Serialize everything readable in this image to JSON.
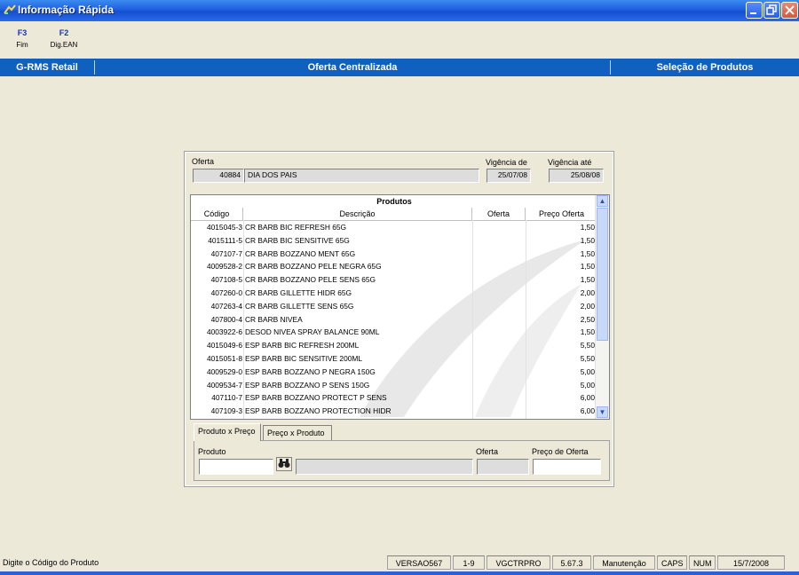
{
  "window": {
    "title": "Informação Rápida",
    "title_icon": "app-icon",
    "controls": [
      "minimize-icon",
      "restore-icon",
      "close-icon"
    ]
  },
  "shortcuts": [
    {
      "key": "F3",
      "label": "Fim"
    },
    {
      "key": "F2",
      "label": "Dig.EAN"
    }
  ],
  "header": {
    "app": "G-RMS Retail",
    "module": "Oferta Centralizada",
    "screen": "Seleção de Produtos"
  },
  "oferta": {
    "label": "Oferta",
    "codigo": "40884",
    "descricao": "DIA DOS PAIS",
    "vigencia_de_label": "Vigência de",
    "vigencia_de": "25/07/08",
    "vigencia_ate_label": "Vigência até",
    "vigencia_ate": "25/08/08"
  },
  "produtos": {
    "caption": "Produtos",
    "columns": [
      "Código",
      "Descrição",
      "Oferta",
      "Preço Oferta"
    ],
    "rows": [
      {
        "codigo": "4015045-3",
        "descricao": "CR BARB BIC REFRESH 65G",
        "oferta": "",
        "preco": "1,50"
      },
      {
        "codigo": "4015111-5",
        "descricao": "CR BARB BIC SENSITIVE 65G",
        "oferta": "",
        "preco": "1,50"
      },
      {
        "codigo": "407107-7",
        "descricao": "CR BARB BOZZANO MENT 65G",
        "oferta": "",
        "preco": "1,50"
      },
      {
        "codigo": "4009528-2",
        "descricao": "CR BARB BOZZANO PELE NEGRA 65G",
        "oferta": "",
        "preco": "1,50"
      },
      {
        "codigo": "407108-5",
        "descricao": "CR BARB BOZZANO PELE SENS 65G",
        "oferta": "",
        "preco": "1,50"
      },
      {
        "codigo": "407260-0",
        "descricao": "CR BARB GILLETTE HIDR 65G",
        "oferta": "",
        "preco": "2,00"
      },
      {
        "codigo": "407263-4",
        "descricao": "CR BARB GILLETTE SENS 65G",
        "oferta": "",
        "preco": "2,00"
      },
      {
        "codigo": "407800-4",
        "descricao": "CR BARB NIVEA",
        "oferta": "",
        "preco": "2,50"
      },
      {
        "codigo": "4003922-6",
        "descricao": "DESOD NIVEA SPRAY BALANCE 90ML",
        "oferta": "",
        "preco": "1,50"
      },
      {
        "codigo": "4015049-6",
        "descricao": "ESP BARB BIC REFRESH 200ML",
        "oferta": "",
        "preco": "5,50"
      },
      {
        "codigo": "4015051-8",
        "descricao": "ESP BARB BIC SENSITIVE 200ML",
        "oferta": "",
        "preco": "5,50"
      },
      {
        "codigo": "4009529-0",
        "descricao": "ESP BARB BOZZANO P NEGRA 150G",
        "oferta": "",
        "preco": "5,00"
      },
      {
        "codigo": "4009534-7",
        "descricao": "ESP BARB BOZZANO P SENS 150G",
        "oferta": "",
        "preco": "5,00"
      },
      {
        "codigo": "407110-7",
        "descricao": "ESP BARB BOZZANO PROTECT P SENS",
        "oferta": "",
        "preco": "6,00"
      },
      {
        "codigo": "407109-3",
        "descricao": "ESP BARB BOZZANO PROTECTION HIDR",
        "oferta": "",
        "preco": "6,00"
      }
    ]
  },
  "tabs": [
    {
      "label": "Produto x Preço",
      "active": true
    },
    {
      "label": "Preço x Produto",
      "active": false
    }
  ],
  "form": {
    "produto_label": "Produto",
    "produto_value": "",
    "descricao_value": "",
    "oferta_label": "Oferta",
    "oferta_value": "",
    "preco_label": "Preço de Oferta",
    "preco_value": ""
  },
  "status": {
    "message": "Digite o Código do Produto",
    "cells": [
      "VERSAO567",
      "1-9",
      "VGCTRPRO",
      "5.67.3",
      "Manutenção",
      "CAPS",
      "NUM",
      "15/7/2008"
    ]
  }
}
